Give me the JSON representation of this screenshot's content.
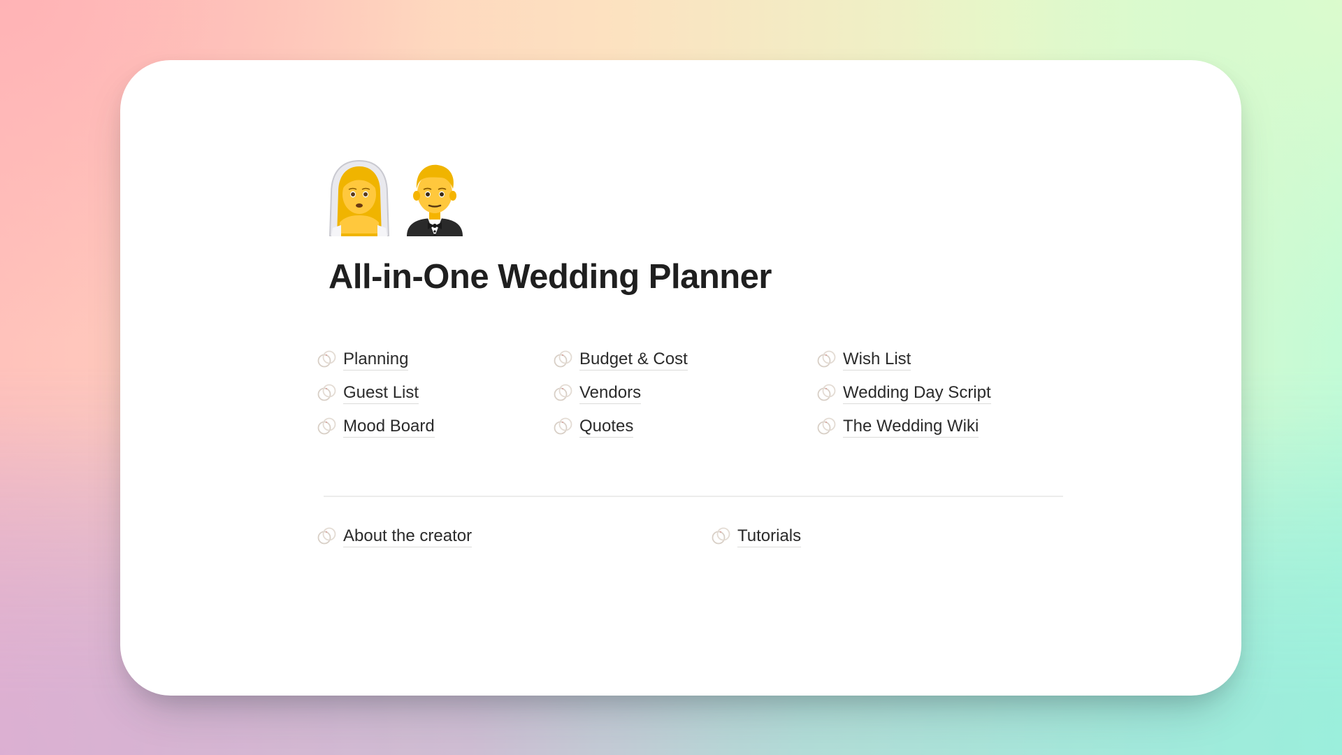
{
  "page": {
    "title": "All-in-One Wedding Planner",
    "icons": [
      "bride-with-veil-emoji",
      "man-in-tuxedo-emoji"
    ]
  },
  "links": {
    "columns": [
      [
        {
          "label": "Planning",
          "icon": "wedding-rings-icon"
        },
        {
          "label": "Guest List",
          "icon": "wedding-rings-icon"
        },
        {
          "label": "Mood Board",
          "icon": "wedding-rings-icon"
        }
      ],
      [
        {
          "label": "Budget & Cost",
          "icon": "wedding-rings-icon"
        },
        {
          "label": "Vendors",
          "icon": "wedding-rings-icon"
        },
        {
          "label": "Quotes",
          "icon": "wedding-rings-icon"
        }
      ],
      [
        {
          "label": "Wish List",
          "icon": "wedding-rings-icon"
        },
        {
          "label": "Wedding Day Script",
          "icon": "wedding-rings-icon"
        },
        {
          "label": "The Wedding Wiki",
          "icon": "wedding-rings-icon"
        }
      ]
    ],
    "footer": [
      {
        "label": "About the creator",
        "icon": "wedding-rings-icon"
      },
      {
        "label": "Tutorials",
        "icon": "wedding-rings-icon"
      }
    ]
  },
  "colors": {
    "text": "#2b2b2b",
    "title": "#1f1f1f",
    "card": "#ffffff",
    "gradient_top_left": "#ffb3b6",
    "gradient_top_mid": "#fde1c0",
    "gradient_top_right": "#dbfbcd",
    "gradient_bottom_left": "#d6afd5",
    "gradient_bottom_right": "#95f0dc"
  }
}
